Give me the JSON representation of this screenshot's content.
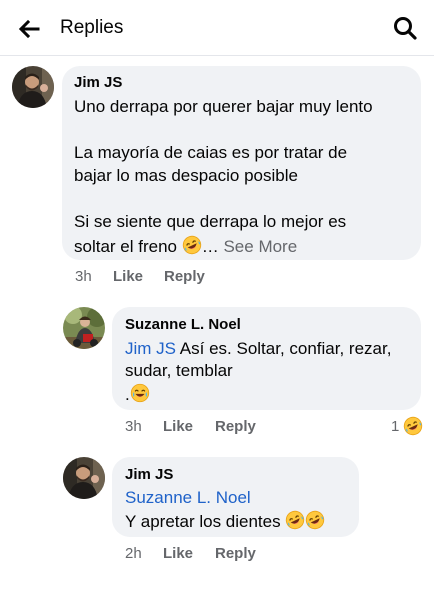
{
  "header": {
    "title": "Replies"
  },
  "comments": [
    {
      "author": "Jim JS",
      "lines": [
        "Uno derrapa por querer bajar muy lento",
        "La mayoría de caias es por tratar de",
        "bajar lo mas despacio posible",
        "Si se siente que derrapa lo mejor es",
        "soltar el freno"
      ],
      "ellipsis": "…",
      "see_more": "See More",
      "time": "3h",
      "like": "Like",
      "reply": "Reply"
    },
    {
      "author": "Suzanne L. Noel",
      "mention": "Jim JS",
      "lines": [
        "Así es. Soltar, confiar, rezar,",
        "sudar, temblar",
        "."
      ],
      "time": "3h",
      "like": "Like",
      "reply": "Reply",
      "reaction_count": "1"
    },
    {
      "author": "Jim JS",
      "mention": "Suzanne L. Noel",
      "lines": [
        "Y apretar los dientes"
      ],
      "time": "2h",
      "like": "Like",
      "reply": "Reply"
    }
  ],
  "icons": {
    "back": "arrow-left-icon",
    "search": "magnifier-icon",
    "laugh": "rolling-laughing-emoji",
    "joy": "tears-of-joy-emoji",
    "haha_reaction": "haha-reaction-icon"
  },
  "colors": {
    "link": "#1f62c9",
    "secondary": "#65676b",
    "bubble": "#f0f2f5"
  }
}
